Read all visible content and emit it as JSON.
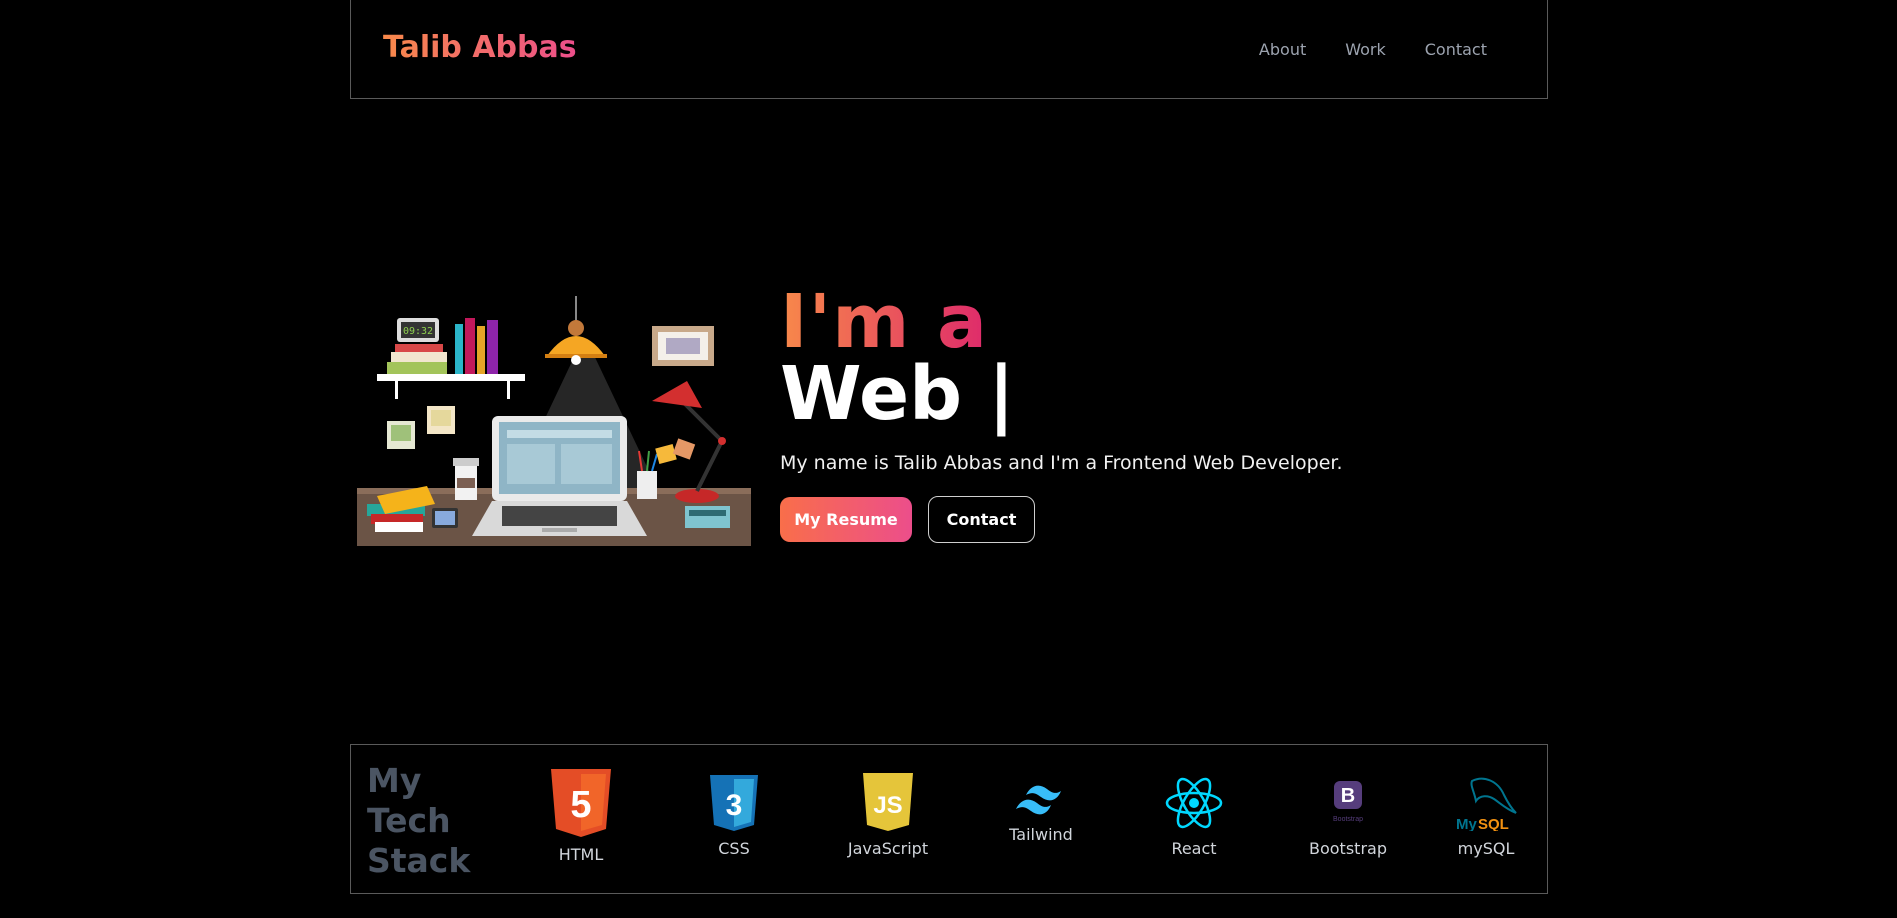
{
  "header": {
    "logo": "Talib Abbas",
    "nav": [
      "About",
      "Work",
      "Contact"
    ]
  },
  "hero": {
    "clock_text": "09:32",
    "line1": "I'm a",
    "line2": "Web |",
    "intro": "My name is Talib Abbas and I'm a Frontend Web Developer.",
    "resume_label": "My Resume",
    "contact_label": "Contact"
  },
  "tech_stack": {
    "title": "My Tech Stack",
    "title_lines": [
      "My",
      "Tech",
      "Stack"
    ],
    "items": [
      {
        "name": "HTML",
        "icon": "html5-icon",
        "color": "#e44d26"
      },
      {
        "name": "CSS",
        "icon": "css3-icon",
        "color": "#1572b6"
      },
      {
        "name": "JavaScript",
        "icon": "javascript-icon",
        "color": "#e5c53a"
      },
      {
        "name": "Tailwind",
        "icon": "tailwind-icon",
        "color": "#38bdf8"
      },
      {
        "name": "React",
        "icon": "react-icon",
        "color": "#00d8ff"
      },
      {
        "name": "Bootstrap",
        "icon": "bootstrap-icon",
        "color": "#563d7c"
      },
      {
        "name": "mySQL",
        "icon": "mysql-icon",
        "color": "#00758f"
      }
    ],
    "icon_text": {
      "html": "5",
      "css": "3",
      "js": "JS",
      "bootstrap": "B",
      "bootstrap_small": "Bootstrap",
      "mysql_a": "My",
      "mysql_b": "SQL"
    }
  },
  "colors": {
    "accent_start": "#f8894a",
    "accent_end": "#ec4e8b",
    "muted": "#4b5563"
  }
}
